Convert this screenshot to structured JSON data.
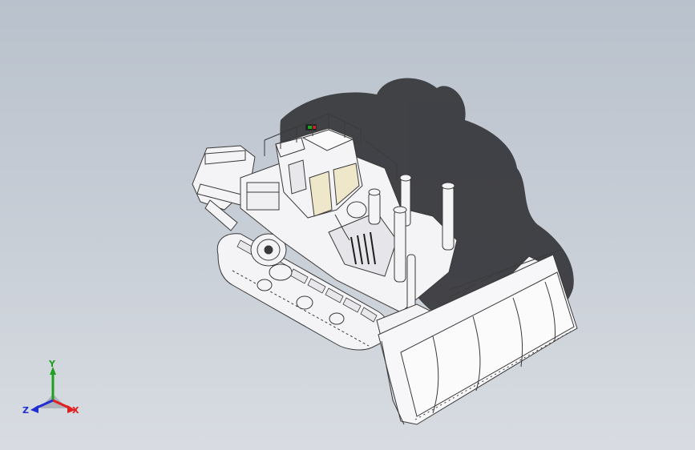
{
  "viewport": {
    "background_top": "#b9c1cc",
    "background_bottom": "#d8dce2"
  },
  "model": {
    "name": "bulldozer-assembly",
    "body_color": "#f4f4f6",
    "edge_color": "#3a3a3a",
    "shadow_color": "#2a2a2e",
    "glass_color": "#efe7c9"
  },
  "triad": {
    "x_label": "X",
    "y_label": "Y",
    "z_label": "Z",
    "x_color": "#e02020",
    "y_color": "#20a020",
    "z_color": "#2030d0"
  }
}
